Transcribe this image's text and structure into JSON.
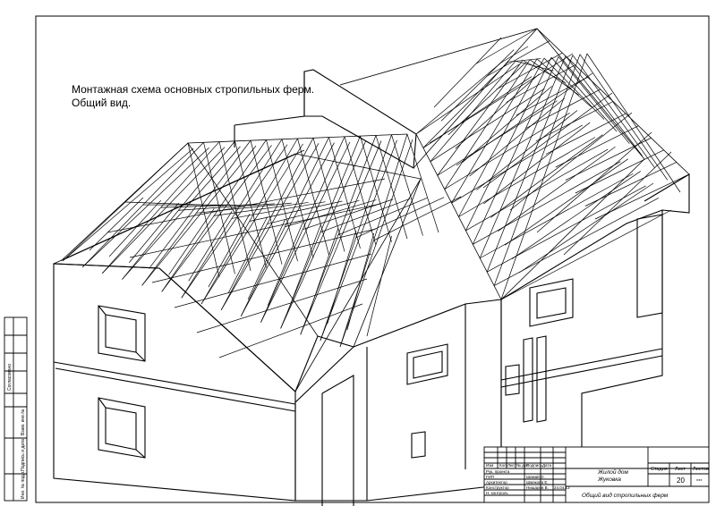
{
  "drawing": {
    "title_line1": "Монтажная схема основных стропильных ферм.",
    "title_line2": "Общий вид."
  },
  "side_stamp": {
    "approved": "Согласовано",
    "inv_orig": "Инв. № подл.",
    "sign_date": "Подпись и дата",
    "replace_inv": "Взам. инв.№"
  },
  "title_block": {
    "columns": [
      "Изм",
      "Кол",
      "Лист",
      "№ док.",
      "Подпись",
      "Дата"
    ],
    "roles": [
      "Рук. проекта",
      "ГИП",
      "Архитектор",
      "Конструктор",
      "Н. контроль"
    ],
    "names": [
      "",
      "Шамай О.",
      "Шмакова Е.",
      "Нищаров В.",
      ""
    ],
    "date": "24.04.13",
    "object_line1": "Жилой дом",
    "object_line2": "Жуковка",
    "stage_hdr": "Стадия",
    "sheet_hdr": "Лист",
    "sheets_hdr": "Листов",
    "sheet_no": "20",
    "sheets_total": "***",
    "sheet_title": "Общий вид стропильных ферм"
  }
}
